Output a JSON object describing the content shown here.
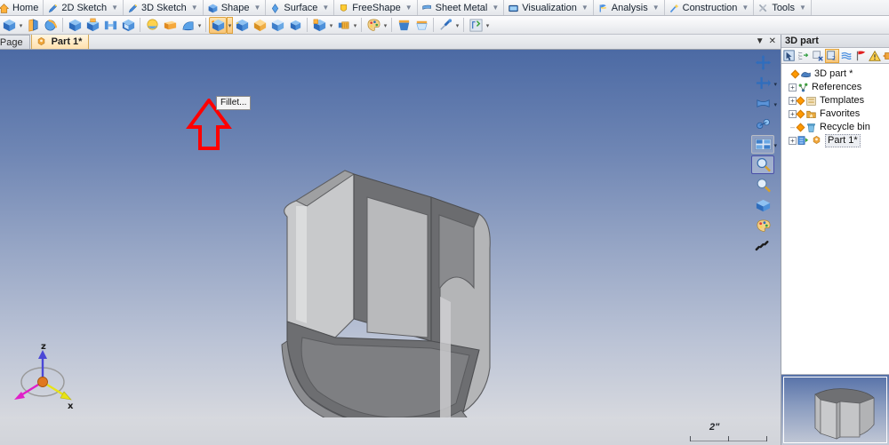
{
  "app": {
    "ribbon_tabs": [
      {
        "label": "Home",
        "icon": "home-icon",
        "has_caret": false
      },
      {
        "label": "2D Sketch",
        "icon": "pencil-blue-icon",
        "has_caret": true
      },
      {
        "label": "3D Sketch",
        "icon": "pencil-blue-icon",
        "has_caret": true
      },
      {
        "label": "Shape",
        "icon": "blue-cube-icon",
        "has_caret": true
      },
      {
        "label": "Surface",
        "icon": "blue-surface-icon",
        "has_caret": true
      },
      {
        "label": "FreeShape",
        "icon": "yellow-shield-icon",
        "has_caret": true
      },
      {
        "label": "Sheet Metal",
        "icon": "sheet-metal-icon",
        "has_caret": true
      },
      {
        "label": "Visualization",
        "icon": "monitor-icon",
        "has_caret": true
      },
      {
        "label": "Analysis",
        "icon": "analysis-flag-icon",
        "has_caret": true
      },
      {
        "label": "Construction",
        "icon": "construction-wand-icon",
        "has_caret": true
      },
      {
        "label": "Tools",
        "icon": "tools-wrench-icon",
        "has_caret": true
      }
    ],
    "toolbar_groups": [
      {
        "buttons": [
          {
            "name": "extrude-tool",
            "icon": "blue-cube-icon",
            "dropdown": true,
            "active": false
          },
          {
            "name": "loft-tool",
            "icon": "loft-icon",
            "dropdown": false,
            "active": false
          },
          {
            "name": "sweep-tool",
            "icon": "sweep-globe-icon",
            "dropdown": false,
            "active": false
          }
        ]
      },
      {
        "buttons": [
          {
            "name": "box-tool",
            "icon": "blue-cube-icon",
            "dropdown": false,
            "active": false
          },
          {
            "name": "cube-primitive-tool",
            "icon": "cube-primitive-icon",
            "dropdown": false,
            "active": false
          },
          {
            "name": "pattern-tool",
            "icon": "pattern-icon",
            "dropdown": false,
            "active": false
          },
          {
            "name": "shell-tool",
            "icon": "shell-cube-icon",
            "dropdown": false,
            "active": false
          }
        ]
      },
      {
        "buttons": [
          {
            "name": "sphere-tool",
            "icon": "sphere-icon",
            "dropdown": false,
            "active": false
          },
          {
            "name": "prism-tool",
            "icon": "orange-prism-icon",
            "dropdown": false,
            "active": false
          },
          {
            "name": "cone-tool",
            "icon": "cone-icon",
            "dropdown": true,
            "active": false
          }
        ]
      },
      {
        "buttons": [
          {
            "name": "fillet-tool",
            "icon": "fillet-cube-icon",
            "dropdown": true,
            "active": true
          },
          {
            "name": "chamfer-tool",
            "icon": "chamfer-cube-icon",
            "dropdown": false,
            "active": false
          },
          {
            "name": "draft-tool",
            "icon": "draft-cube-icon",
            "dropdown": false,
            "active": false
          },
          {
            "name": "taper-tool",
            "icon": "taper-cube-icon",
            "dropdown": false,
            "active": false
          },
          {
            "name": "offset-tool",
            "icon": "offset-cube-icon",
            "dropdown": true,
            "active": false
          }
        ]
      },
      {
        "buttons": [
          {
            "name": "boolean-tool",
            "icon": "boolean-cube-icon",
            "dropdown": true,
            "active": false
          },
          {
            "name": "thread-tool",
            "icon": "thread-icon",
            "dropdown": true,
            "active": false
          }
        ]
      },
      {
        "buttons": [
          {
            "name": "material-tool",
            "icon": "palette-icon",
            "dropdown": true,
            "active": false
          }
        ]
      },
      {
        "buttons": [
          {
            "name": "split-tool",
            "icon": "split-cube-icon",
            "dropdown": false,
            "active": false
          },
          {
            "name": "trim-tool",
            "icon": "trim-cube-icon",
            "dropdown": false,
            "active": false
          }
        ]
      },
      {
        "buttons": [
          {
            "name": "measure-tool",
            "icon": "measure-pin-icon",
            "dropdown": true,
            "active": false
          }
        ]
      },
      {
        "buttons": [
          {
            "name": "macro-tool",
            "icon": "macro-icon",
            "dropdown": true,
            "active": false
          }
        ]
      }
    ],
    "document_tabs": [
      {
        "label": "art Page",
        "icon": "",
        "active": false
      },
      {
        "label": "Part 1*",
        "icon": "part-icon",
        "active": true
      }
    ],
    "doc_controls": {
      "dropdown": "▼",
      "close": "✕"
    },
    "tooltip": {
      "text": "Fillet..."
    }
  },
  "viewport": {
    "view_toolbar": [
      {
        "name": "fit-all-icon",
        "dropdown": false,
        "style": "plain"
      },
      {
        "name": "pan-icon",
        "dropdown": true,
        "style": "plain"
      },
      {
        "name": "rotate-icon",
        "dropdown": true,
        "style": "plain"
      },
      {
        "name": "orbit-icon",
        "dropdown": false,
        "style": "plain"
      },
      {
        "name": "standard-views-icon",
        "dropdown": true,
        "style": "box"
      },
      {
        "name": "zoom-window-icon",
        "dropdown": false,
        "style": "sel"
      },
      {
        "name": "zoom-icon",
        "dropdown": false,
        "style": "plain"
      },
      {
        "name": "render-mode-icon",
        "dropdown": false,
        "style": "plain"
      },
      {
        "name": "display-style-icon",
        "dropdown": false,
        "style": "plain"
      },
      {
        "name": "drag-handle-icon",
        "dropdown": false,
        "style": "plain"
      }
    ],
    "axis_triad": {
      "z_label": "z",
      "x_label": "x"
    },
    "scale_bar": {
      "label": "2\""
    }
  },
  "right_panel": {
    "title": "3D part",
    "toolbar": [
      {
        "name": "select-tool-icon",
        "active": false
      },
      {
        "name": "expand-tree-icon",
        "active": false
      },
      {
        "name": "collapse-tree-icon",
        "active": false
      },
      {
        "name": "filter-tree-icon",
        "active": true
      },
      {
        "name": "layers-icon",
        "active": false
      },
      {
        "name": "flag-icon",
        "active": false
      },
      {
        "name": "warning-icon",
        "active": false
      },
      {
        "name": "properties-icon",
        "active": false
      }
    ],
    "tree": [
      {
        "label": "3D part *",
        "indent": 0,
        "expander": "none",
        "diamond": true,
        "icon": "part-blue-icon",
        "selected": false
      },
      {
        "label": "References",
        "indent": 1,
        "expander": "plus",
        "diamond": false,
        "icon": "references-icon",
        "selected": false
      },
      {
        "label": "Templates",
        "indent": 1,
        "expander": "plus",
        "diamond": true,
        "icon": "templates-folder-icon",
        "selected": false
      },
      {
        "label": "Favorites",
        "indent": 1,
        "expander": "plus",
        "diamond": true,
        "icon": "favorites-folder-icon",
        "selected": false
      },
      {
        "label": "Recycle bin",
        "indent": 1,
        "expander": "leaf",
        "diamond": true,
        "icon": "recycle-bin-icon",
        "selected": false
      },
      {
        "label": "Part 1*",
        "indent": 1,
        "expander": "plus",
        "diamond": true,
        "icon": "part-node-icon",
        "selected": true
      }
    ]
  },
  "colors": {
    "viewport_top": "#4c6aa4",
    "viewport_bottom": "#d6d8de",
    "accent_orange": "#f8c578",
    "callout_red": "#ff0000",
    "model_light": "#c9cacc",
    "model_mid": "#9a9b9d",
    "model_dark": "#6f7073"
  }
}
